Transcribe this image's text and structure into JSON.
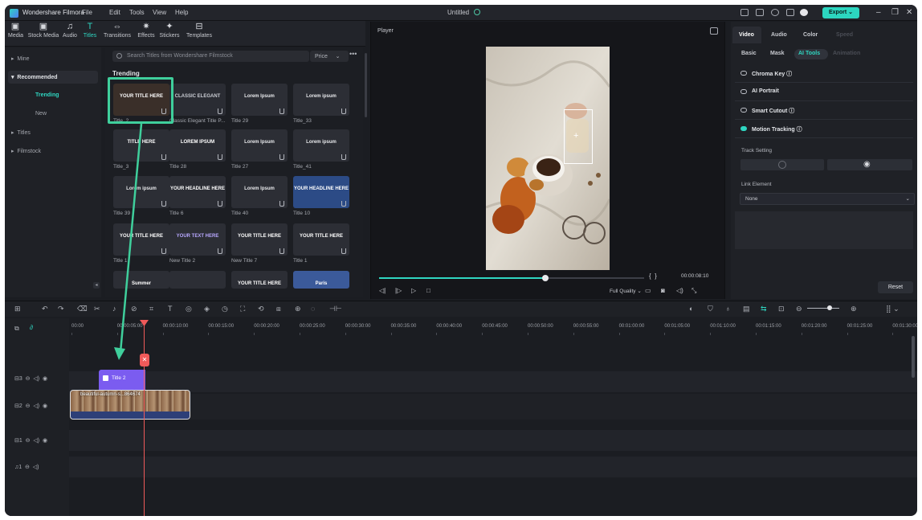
{
  "titlebar": {
    "app_name": "Wondershare Filmora",
    "menus": [
      "File",
      "Edit",
      "Tools",
      "View",
      "Help"
    ],
    "project_name": "Untitled",
    "export_label": "Export"
  },
  "media_tabs": [
    {
      "label": "Media",
      "icon": "media-icon"
    },
    {
      "label": "Stock Media",
      "icon": "stock-media-icon"
    },
    {
      "label": "Audio",
      "icon": "audio-icon"
    },
    {
      "label": "Titles",
      "icon": "titles-icon",
      "active": true
    },
    {
      "label": "Transitions",
      "icon": "transitions-icon"
    },
    {
      "label": "Effects",
      "icon": "effects-icon"
    },
    {
      "label": "Stickers",
      "icon": "stickers-icon"
    },
    {
      "label": "Templates",
      "icon": "templates-icon"
    }
  ],
  "sidebar": {
    "items": [
      {
        "label": "Mine"
      },
      {
        "label": "Recommended"
      },
      {
        "label": "Trending"
      },
      {
        "label": "New"
      },
      {
        "label": "Titles"
      },
      {
        "label": "Filmstock"
      }
    ]
  },
  "library": {
    "search_placeholder": "Search Titles from Wondershare Filmstock",
    "price_filter": "Price",
    "section_title": "Trending",
    "tiles": [
      {
        "thumb": "YOUR TITLE HERE",
        "caption": "Title_2"
      },
      {
        "thumb": "CLASSIC ELEGANT",
        "caption": "Classic Elegant Title P..."
      },
      {
        "thumb": "Lorem Ipsum",
        "caption": "Title 29"
      },
      {
        "thumb": "Lorem ipsum",
        "caption": "Title_33"
      },
      {
        "thumb": "TITLE HERE",
        "caption": "Title_3"
      },
      {
        "thumb": "LOREM IPSUM",
        "caption": "Title 28"
      },
      {
        "thumb": "Lorem Ipsum",
        "caption": "Title 27"
      },
      {
        "thumb": "Lorem ipsum",
        "caption": "Title_41"
      },
      {
        "thumb": "Lorem ipsum",
        "caption": "Title 39"
      },
      {
        "thumb": "YOUR HEADLINE HERE",
        "caption": "Title 6"
      },
      {
        "thumb": "Lorem Ipsum",
        "caption": "Title 40"
      },
      {
        "thumb": "YOUR HEADLINE HERE",
        "caption": "Title 10"
      },
      {
        "thumb": "YOUR TITLE HERE",
        "caption": "Title 1"
      },
      {
        "thumb": "YOUR TEXT HERE",
        "caption": "New Title 2"
      },
      {
        "thumb": "YOUR TITLE HERE",
        "caption": "New Title 7"
      },
      {
        "thumb": "YOUR TITLE HERE",
        "caption": "Title 1"
      },
      {
        "thumb": "Summer",
        "caption": ""
      },
      {
        "thumb": "",
        "caption": ""
      },
      {
        "thumb": "YOUR TITLE HERE",
        "caption": ""
      },
      {
        "thumb": "Paris",
        "caption": ""
      }
    ]
  },
  "player": {
    "label": "Player",
    "timecode": "00:00:08:10",
    "quality": "Full Quality"
  },
  "properties": {
    "tabs": [
      "Video",
      "Audio",
      "Color",
      "Speed"
    ],
    "subtabs": [
      "Basic",
      "Mask",
      "AI Tools",
      "Animation"
    ],
    "features": [
      "Chroma Key",
      "AI Portrait",
      "Smart Cutout",
      "Motion Tracking"
    ],
    "track_setting_label": "Track Setting",
    "link_element_label": "Link Element",
    "link_element_value": "None",
    "reset_label": "Reset"
  },
  "timeline": {
    "ruler_labels": [
      "00:00",
      "00:00:05:00",
      "00:00:10:00",
      "00:00:15:00",
      "00:00:20:00",
      "00:00:25:00",
      "00:00:30:00",
      "00:00:35:00",
      "00:00:40:00",
      "00:00:45:00",
      "00:00:50:00",
      "00:00:55:00",
      "00:01:00:00",
      "00:01:05:00",
      "00:01:10:00",
      "00:01:15:00",
      "00:01:20:00",
      "00:01:25:00",
      "00:01:30:00"
    ],
    "tracks": [
      "3",
      "2",
      "1",
      "1"
    ],
    "title_clip": "Title 2",
    "video_clip": "beautiful-autumn-s...864674"
  },
  "colors": {
    "accent": "#2fd6c1",
    "title_clip": "#7b5cf0",
    "playhead": "#f05a5a",
    "annotation": "#3fcf9c"
  }
}
